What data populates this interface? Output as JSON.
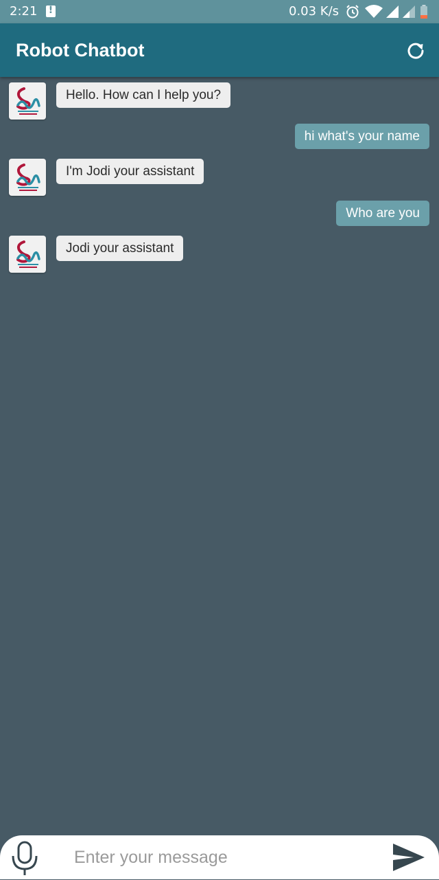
{
  "status_bar": {
    "time": "2:21",
    "speed": "0.03 K/s",
    "icons": [
      "alert-icon",
      "alarm-clock-icon",
      "wifi-icon",
      "cell-signal-icon",
      "cell-signal-weak-icon",
      "battery-icon"
    ]
  },
  "app_bar": {
    "title": "Robot Chatbot",
    "action_icon": "refresh-icon"
  },
  "chat": {
    "messages": [
      {
        "sender": "bot",
        "text": "Hello. How can I help you?"
      },
      {
        "sender": "user",
        "text": "hi what's your name"
      },
      {
        "sender": "bot",
        "text": "I'm Jodi your assistant"
      },
      {
        "sender": "user",
        "text": "Who are you"
      },
      {
        "sender": "bot",
        "text": "Jodi your assistant"
      }
    ]
  },
  "input_bar": {
    "placeholder": "Enter your message",
    "value": "",
    "left_icon": "microphone-icon",
    "right_icon": "send-icon"
  },
  "colors": {
    "status_bar": "#5f929c",
    "app_bar": "#1f6b7f",
    "background": "#475a65",
    "bot_bubble": "#eeeeee",
    "user_bubble": "#6ba0aa"
  }
}
